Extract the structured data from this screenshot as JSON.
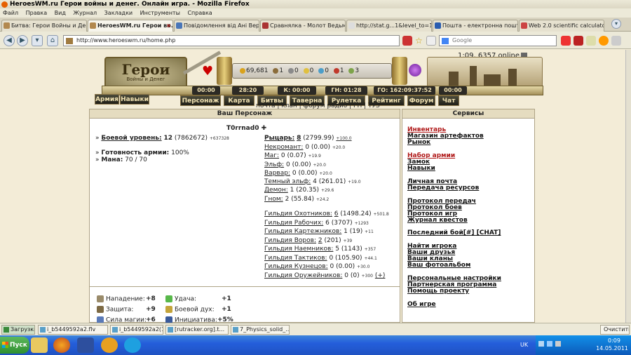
{
  "window": {
    "title": "HeroesWM.ru Герои войны и денег. Онлайн игра. - Mozilla Firefox"
  },
  "menu": [
    "Файл",
    "Правка",
    "Вид",
    "Журнал",
    "Закладки",
    "Инструменты",
    "Справка"
  ],
  "tabs": [
    {
      "label": "Битва: Герои Войны и Ден..."
    },
    {
      "label": "HeroesWM.ru Герои во..."
    },
    {
      "label": "Повідомлення від Ані Вере..."
    },
    {
      "label": "Сравнялка - Молот Ведьм ..."
    },
    {
      "label": "http://stat.g...1&level_to=17"
    },
    {
      "label": "Пошта - електронна пошт..."
    },
    {
      "label": "Web 2.0 scientific calculator"
    }
  ],
  "nav": {
    "url": "http://www.heroeswm.ru/home.php",
    "search_placeholder": "Google"
  },
  "game": {
    "online": "1:09, 6357 online",
    "logo": {
      "title": "Герои",
      "subtitle": "Войны и Денег"
    },
    "resources": [
      {
        "value": "69,681",
        "color": "#d9a21b",
        "icon": "gold-icon"
      },
      {
        "value": "1",
        "color": "#8a6c3a",
        "icon": "wood-icon"
      },
      {
        "value": "0",
        "color": "#8a8a8a",
        "icon": "ore-icon"
      },
      {
        "value": "0",
        "color": "#e0c040",
        "icon": "sulfur-icon"
      },
      {
        "value": "0",
        "color": "#4c9ec9",
        "icon": "crystal-icon"
      },
      {
        "value": "1",
        "color": "#c0392b",
        "icon": "mercury-icon"
      },
      {
        "value": "3",
        "color": "#7da34a",
        "icon": "gems-icon"
      }
    ],
    "timers": [
      "00:00",
      "28:20",
      "К: 00:00",
      "ГН: 01:28",
      "ГО: 162:09:37:52",
      "00:00"
    ],
    "side_tabs": [
      "Армия",
      "Навыки"
    ],
    "main_tabs": [
      "Персонаж",
      "Карта",
      "Битвы",
      "Таверна",
      "Рулетка",
      "Рейтинг",
      "Форум",
      "Чат"
    ],
    "sublinks": "почта | клан | форум радио | ГН | ТУЗ"
  },
  "character": {
    "panel_title": "Ваш Персонаж",
    "name": "T0rrnad0",
    "combat_level_label": "Боевой уровень:",
    "combat_level": "12",
    "combat_exp": "(7862672)",
    "combat_exp_delta": "+637328",
    "army_ready_label": "Готовность армии:",
    "army_ready": "100%",
    "mana_label": "Мана:",
    "mana": "70 / 70",
    "factions": [
      {
        "name": "Рыцарь:",
        "level": "8",
        "points": "(2799.99)",
        "delta": "+100.0",
        "bold": true
      },
      {
        "name": "Некромант:",
        "level": "0",
        "points": "(0.00)",
        "delta": "+20.0"
      },
      {
        "name": "Маг:",
        "level": "0",
        "points": "(0.07)",
        "delta": "+19.9"
      },
      {
        "name": "Эльф:",
        "level": "0",
        "points": "(0.00)",
        "delta": "+20.0"
      },
      {
        "name": "Варвар:",
        "level": "0",
        "points": "(0.00)",
        "delta": "+20.0"
      },
      {
        "name": "Темный эльф:",
        "level": "4",
        "points": "(261.01)",
        "delta": "+19.0"
      },
      {
        "name": "Демон:",
        "level": "1",
        "points": "(20.35)",
        "delta": "+29.6"
      },
      {
        "name": "Гном:",
        "level": "2",
        "points": "(55.84)",
        "delta": "+24.2"
      }
    ],
    "guilds": [
      {
        "name": "Гильдия Охотников:",
        "level": "6",
        "points": "(1498.24)",
        "delta": "+501.8"
      },
      {
        "name": "Гильдия Рабочих:",
        "level": "6",
        "points": "(3707)",
        "delta": "+1293"
      },
      {
        "name": "Гильдия Картежников:",
        "level": "1",
        "points": "(19)",
        "delta": "+11"
      },
      {
        "name": "Гильдия Воров:",
        "level": "2",
        "points": "(201)",
        "delta": "+39"
      },
      {
        "name": "Гильдия Наемников:",
        "level": "5",
        "points": "(1143)",
        "delta": "+357"
      },
      {
        "name": "Гильдия Тактиков:",
        "level": "0",
        "points": "(105.90)",
        "delta": "+44.1"
      },
      {
        "name": "Гильдия Кузнецов:",
        "level": "0",
        "points": "(0.00)",
        "delta": "+30.0"
      },
      {
        "name": "Гильдия Оружейников:",
        "level": "0",
        "points": "(0)",
        "delta": "+300",
        "extra": "(+)"
      }
    ]
  },
  "stats": {
    "left": [
      {
        "label": "Нападение:",
        "value": "+8",
        "color": "#9a8b6a",
        "icon": "attack-icon"
      },
      {
        "label": "Защита:",
        "value": "+9",
        "color": "#7d6a44",
        "icon": "defense-icon"
      },
      {
        "label": "Сила магии:",
        "value": "+6",
        "color": "#5a7ab8",
        "icon": "spellpower-icon"
      }
    ],
    "right": [
      {
        "label": "Удача:",
        "value": "+1",
        "color": "#58b84a",
        "icon": "luck-icon"
      },
      {
        "label": "Боевой дух:",
        "value": "+1",
        "color": "#c4a43a",
        "icon": "morale-icon"
      },
      {
        "label": "Инициатива:",
        "value": "+5%",
        "color": "#3a5a9a",
        "icon": "initiative-icon"
      }
    ]
  },
  "services": {
    "panel_title": "Сервисы",
    "groups": [
      [
        {
          "label": "Инвентарь",
          "red": true
        },
        {
          "label": "Магазин артефактов"
        },
        {
          "label": "Рынок"
        }
      ],
      [
        {
          "label": "Набор армии",
          "red": true
        },
        {
          "label": "Замок"
        },
        {
          "label": "Навыки"
        }
      ],
      [
        {
          "label": "Личная почта"
        },
        {
          "label": "Передача ресурсов"
        }
      ],
      [
        {
          "label": "Протокол передач"
        },
        {
          "label": "Протокол боев"
        },
        {
          "label": "Протокол игр"
        },
        {
          "label": "Журнал квестов"
        }
      ],
      [
        {
          "label": "Последний бой[#] [CHAT]"
        }
      ],
      [
        {
          "label": "Найти игрока"
        },
        {
          "label": "Ваши друзья"
        },
        {
          "label": "Ваши кланы"
        },
        {
          "label": "Ваш фотоальбом"
        }
      ],
      [
        {
          "label": "Персональные настройки"
        },
        {
          "label": "Партнерская программа"
        },
        {
          "label": "Помощь проекту"
        }
      ],
      [
        {
          "label": "Об игре"
        }
      ]
    ]
  },
  "downloads": {
    "label": "Загрузки",
    "items": [
      "i_b5449592a2.flv",
      "i_b5449592a2(1)...",
      "[rutracker.org].t...",
      "7_Physics_solid_..."
    ],
    "clear": "Очистить"
  },
  "taskbar": {
    "start": "Пуск",
    "lang": "UK",
    "time": "0:09",
    "date": "14.05.2011"
  }
}
